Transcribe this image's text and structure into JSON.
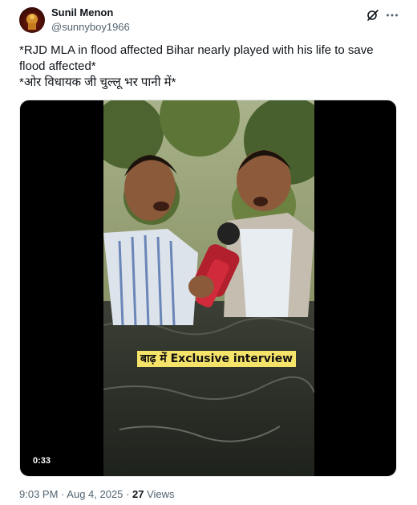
{
  "author": {
    "name": "Sunil Menon",
    "handle": "@sunnyboy1966"
  },
  "icons": {
    "grok": "grok-icon",
    "more": "more-horizontal-icon"
  },
  "tweet": {
    "text": "*RJD MLA in flood affected Bihar nearly played with his life to save flood affected*\n*ओर विधायक जी चुल्लू भर पानी में*"
  },
  "video": {
    "caption": "बाढ़ में Exclusive  interview",
    "duration": "0:33"
  },
  "meta": {
    "time": "9:03 PM",
    "separator1": "·",
    "date": "Aug 4, 2025",
    "separator2": "·",
    "views_count": "27",
    "views_label": "Views"
  },
  "colors": {
    "text_primary": "#0f1419",
    "text_secondary": "#536471",
    "caption_bg": "#f6e36a",
    "background": "#ffffff"
  }
}
